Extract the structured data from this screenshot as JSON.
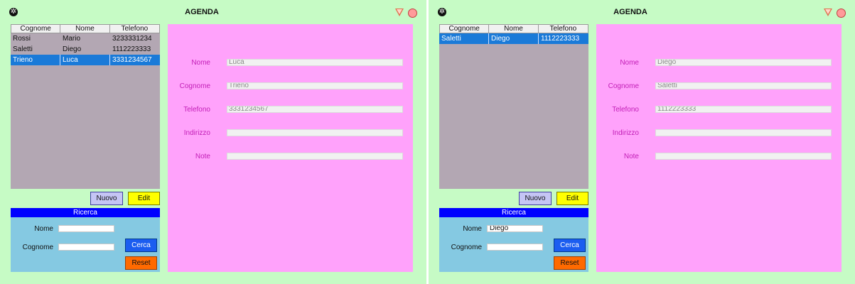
{
  "windows": [
    {
      "title": "AGENDA",
      "table": {
        "headers": [
          "Cognome",
          "Nome",
          "Telefono"
        ],
        "rows": [
          [
            "Rossi",
            "Mario",
            "3233331234"
          ],
          [
            "Saletti",
            "Diego",
            "1112223333"
          ],
          [
            "Trieno",
            "Luca",
            "3331234567"
          ]
        ],
        "selected_index": 2
      },
      "buttons": {
        "nuovo": "Nuovo",
        "edit": "Edit"
      },
      "ricerca": {
        "header": "Ricerca",
        "nome_label": "Nome",
        "nome_value": "",
        "cognome_label": "Cognome",
        "cognome_value": "",
        "cerca": "Cerca",
        "reset": "Reset"
      },
      "detail": [
        {
          "label": "Nome",
          "value": "Luca"
        },
        {
          "label": "Cognome",
          "value": "Trieno"
        },
        {
          "label": "Telefono",
          "value": "3331234567"
        },
        {
          "label": "Indirizzo",
          "value": ""
        },
        {
          "label": "Note",
          "value": ""
        }
      ]
    },
    {
      "title": "AGENDA",
      "table": {
        "headers": [
          "Cognome",
          "Nome",
          "Telefono"
        ],
        "rows": [
          [
            "Saletti",
            "Diego",
            "1112223333"
          ]
        ],
        "selected_index": 0
      },
      "buttons": {
        "nuovo": "Nuovo",
        "edit": "Edit"
      },
      "ricerca": {
        "header": "Ricerca",
        "nome_label": "Nome",
        "nome_value": "Diego",
        "cognome_label": "Cognome",
        "cognome_value": "",
        "cerca": "Cerca",
        "reset": "Reset"
      },
      "detail": [
        {
          "label": "Nome",
          "value": "Diego"
        },
        {
          "label": "Cognome",
          "value": "Saletti"
        },
        {
          "label": "Telefono",
          "value": "1112223333"
        },
        {
          "label": "Indirizzo",
          "value": ""
        },
        {
          "label": "Note",
          "value": ""
        }
      ]
    }
  ],
  "icons": {
    "menu": "gear-icon",
    "minimize": "triangle-down-icon",
    "close": "red-circle-icon"
  },
  "colors": {
    "window_bg": "#c6fbc5",
    "detail_bg": "#ffa2fb",
    "table_bg": "#b3a7b3",
    "selection": "#1a7ad8",
    "ricerca_header": "#0000ff",
    "ricerca_bg": "#85c9e2",
    "cerca": "#1b5df0",
    "reset": "#ff6a00",
    "edit": "#ffff00",
    "nuovo": "#c5c5f5"
  }
}
